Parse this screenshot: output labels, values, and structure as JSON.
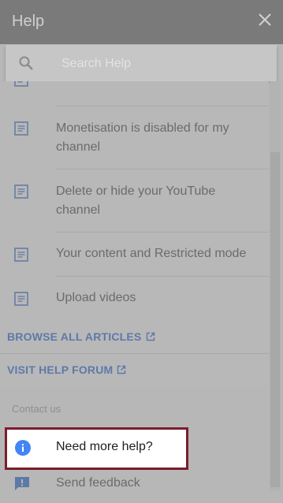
{
  "header": {
    "title": "Help",
    "close_icon": "close-icon"
  },
  "search": {
    "placeholder": "Search Help",
    "icon": "search-icon"
  },
  "articles": [
    {
      "label": "Monetisation is disabled for my channel",
      "icon": "article-icon"
    },
    {
      "label": "Delete or hide your YouTube channel",
      "icon": "article-icon"
    },
    {
      "label": "Your content and Restricted mode",
      "icon": "article-icon"
    },
    {
      "label": "Upload videos",
      "icon": "article-icon"
    }
  ],
  "links": {
    "browse_all": "BROWSE ALL ARTICLES",
    "visit_forum": "VISIT HELP FORUM",
    "icon": "open-in-new-icon"
  },
  "contact": {
    "label": "Contact us",
    "need_help": "Need more help?",
    "send_feedback": "Send feedback"
  },
  "colors": {
    "accent_link": "#5d79a8",
    "info_blue": "#4285f4",
    "highlight_border": "#7a1d2b"
  }
}
